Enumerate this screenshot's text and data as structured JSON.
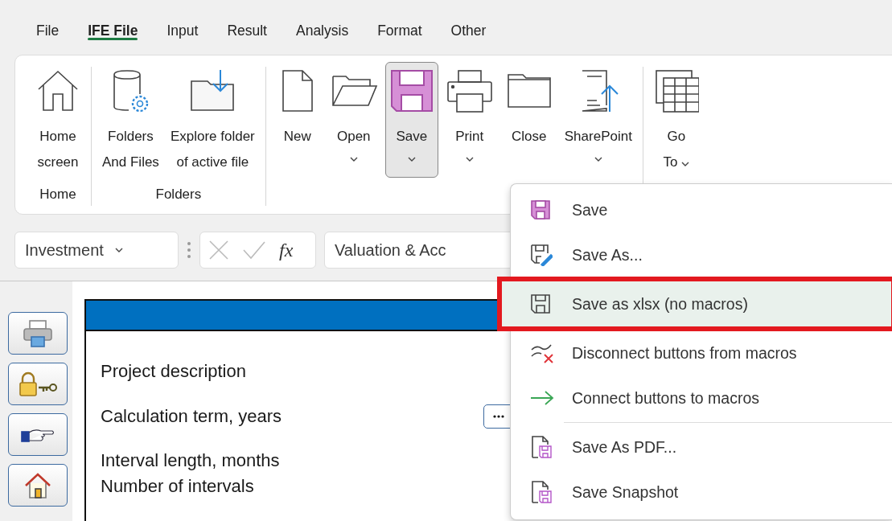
{
  "menu_tabs": [
    {
      "label": "File",
      "selected": false
    },
    {
      "label": "IFE File",
      "selected": true
    },
    {
      "label": "Input",
      "selected": false
    },
    {
      "label": "Result",
      "selected": false
    },
    {
      "label": "Analysis",
      "selected": false
    },
    {
      "label": "Format",
      "selected": false
    },
    {
      "label": "Other",
      "selected": false
    }
  ],
  "ribbon": {
    "groups": [
      {
        "label": "Home",
        "buttons": [
          {
            "label": "Home\nscreen",
            "kind": "home",
            "dropdown": false,
            "pressed": false
          }
        ]
      },
      {
        "label": "Folders",
        "buttons": [
          {
            "label": "Folders\nAnd Files",
            "kind": "db-gear",
            "dropdown": false,
            "pressed": false
          },
          {
            "label": "Explore folder\nof active file",
            "kind": "folder-down",
            "dropdown": false,
            "pressed": false
          }
        ]
      },
      {
        "buttons": [
          {
            "label": "New",
            "kind": "doc",
            "dropdown": false,
            "pressed": false
          },
          {
            "label": "Open",
            "kind": "open",
            "dropdown": true,
            "pressed": false
          },
          {
            "label": "Save",
            "kind": "save",
            "dropdown": true,
            "pressed": true
          },
          {
            "label": "Print",
            "kind": "print",
            "dropdown": true,
            "pressed": false
          },
          {
            "label": "Close",
            "kind": "folder",
            "dropdown": false,
            "pressed": false
          },
          {
            "label": "SharePoint",
            "kind": "upload",
            "dropdown": true,
            "pressed": false
          }
        ]
      },
      {
        "buttons": [
          {
            "label": "Go\nTo",
            "kind": "table",
            "dropdown": true,
            "pressed": false
          }
        ]
      }
    ]
  },
  "formula_bar": {
    "name_box": "Investment",
    "function_label": "fx",
    "formula": "Valuation & Acc"
  },
  "side_buttons": [
    {
      "kind": "printer"
    },
    {
      "kind": "lock-key"
    },
    {
      "kind": "hand"
    },
    {
      "kind": "home"
    }
  ],
  "sheet": {
    "fields": [
      {
        "label": "Project description",
        "picker": false
      },
      {
        "label": "Calculation term, years",
        "picker": true
      },
      {
        "label": "Interval length, months",
        "picker": false
      },
      {
        "label": "Number of intervals",
        "picker": false
      }
    ]
  },
  "save_menu": {
    "items": [
      {
        "label": "Save",
        "kind": "save",
        "selected": false,
        "separator_before": false
      },
      {
        "label": "Save As...",
        "kind": "save-pen",
        "selected": false,
        "separator_before": false
      },
      {
        "label": "Save as xlsx (no macros)",
        "kind": "save-plain",
        "selected": true,
        "separator_before": false
      },
      {
        "label": "Disconnect buttons from macros",
        "kind": "disconnect",
        "selected": false,
        "separator_before": false
      },
      {
        "label": "Connect buttons to macros",
        "kind": "arrow",
        "selected": false,
        "separator_before": false
      },
      {
        "label": "Save As PDF...",
        "kind": "doc-save",
        "selected": false,
        "separator_before": true
      },
      {
        "label": "Save Snapshot",
        "kind": "doc-save",
        "selected": false,
        "separator_before": false
      }
    ]
  }
}
